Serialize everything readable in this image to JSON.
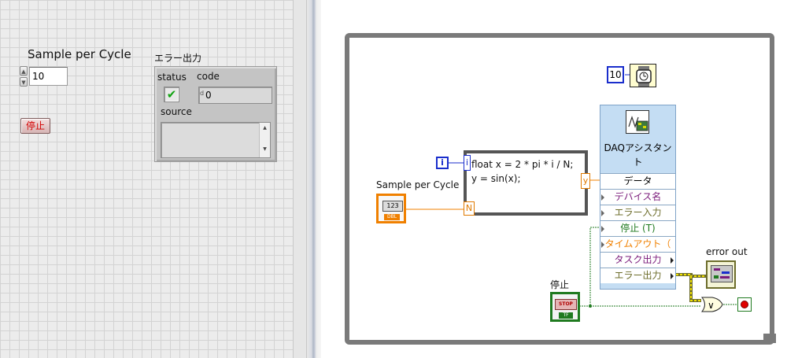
{
  "front_panel": {
    "samples_per_cycle": {
      "label": "Sample per Cycle",
      "value": "10"
    },
    "stop_button": {
      "label": "停止"
    },
    "error_out": {
      "label": "エラー出力",
      "status_label": "status",
      "status_icon": "check-icon",
      "status_symbol": "✔",
      "code_label": "code",
      "code_radix": "d",
      "code_value": "0",
      "source_label": "source",
      "source_value": ""
    }
  },
  "block_diagram": {
    "wait_constant": "10",
    "iteration_terminal": "i",
    "formula_node": {
      "lines": [
        "float x = 2 * pi * i / N;",
        "y = sin(x);"
      ],
      "input_i": "i",
      "input_n": "N",
      "output_y": "y"
    },
    "samples_terminal": {
      "label": "Sample per Cycle",
      "type_text": "123",
      "dtype": "DBL"
    },
    "daq_assistant": {
      "title": "DAQアシスタント",
      "rows": [
        "データ",
        "デバイス名",
        "エラー入力",
        "停止 (T)",
        "タイムアウト（",
        "タスク出力",
        "エラー出力"
      ]
    },
    "stop_terminal": {
      "label": "停止",
      "button_text": "STOP",
      "dtype": "TF"
    },
    "error_out_terminal": {
      "label": "error out"
    },
    "or_function": "∨"
  },
  "colors": {
    "panel_grid_bg": "#ececec",
    "loop_border": "#7a7a7a",
    "int_wire": "#1a2ecc",
    "dbl_wire": "#f08000",
    "bool_wire": "#1f7a1f",
    "error_wire_a": "#6d6d2b",
    "error_wire_b": "#f0e000",
    "daq_bg": "#c4ddf3",
    "row_data": "#000000",
    "row_string": "#7a1a7a",
    "row_error": "#6d6d2b",
    "row_bool": "#1f7a1f",
    "row_timeout": "#f08000"
  }
}
